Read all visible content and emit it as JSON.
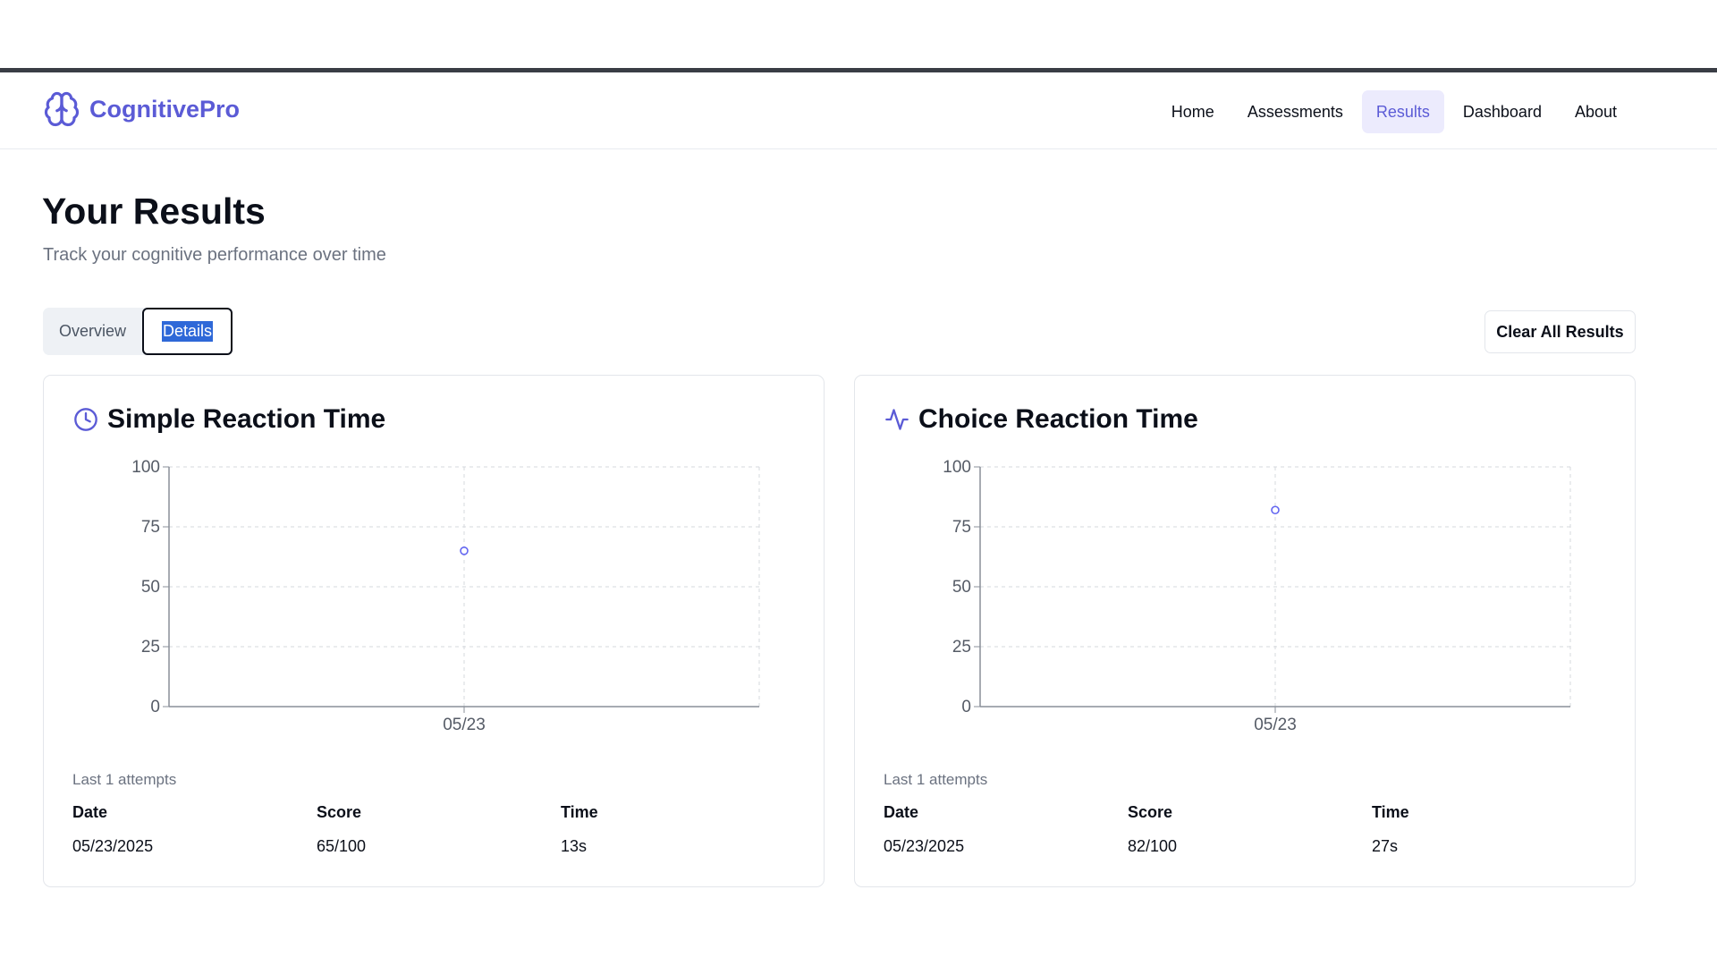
{
  "app": {
    "brand": "CognitivePro",
    "accent_color": "#5b5bd6"
  },
  "nav": {
    "items": [
      {
        "label": "Home",
        "active": false
      },
      {
        "label": "Assessments",
        "active": false
      },
      {
        "label": "Results",
        "active": true
      },
      {
        "label": "Dashboard",
        "active": false
      },
      {
        "label": "About",
        "active": false
      }
    ]
  },
  "page": {
    "title": "Your Results",
    "subtitle": "Track your cognitive performance over time"
  },
  "tabs": {
    "overview": "Overview",
    "details": "Details",
    "selected": "details"
  },
  "actions": {
    "clear_label": "Clear All Results"
  },
  "cards": [
    {
      "title": "Simple Reaction Time",
      "icon": "clock-icon",
      "attempts_label": "Last 1 attempts",
      "table": {
        "headers": [
          "Date",
          "Score",
          "Time"
        ],
        "rows": [
          [
            "05/23/2025",
            "65/100",
            "13s"
          ]
        ]
      }
    },
    {
      "title": "Choice Reaction Time",
      "icon": "activity-icon",
      "attempts_label": "Last 1 attempts",
      "table": {
        "headers": [
          "Date",
          "Score",
          "Time"
        ],
        "rows": [
          [
            "05/23/2025",
            "82/100",
            "27s"
          ]
        ]
      }
    }
  ],
  "chart_data": [
    {
      "type": "scatter",
      "categories": [
        "05/23"
      ],
      "values": [
        65
      ],
      "ylim": [
        0,
        100
      ],
      "yticks": [
        0,
        25,
        50,
        75,
        100
      ],
      "grid": true,
      "color": "#6366f1"
    },
    {
      "type": "scatter",
      "categories": [
        "05/23"
      ],
      "values": [
        82
      ],
      "ylim": [
        0,
        100
      ],
      "yticks": [
        0,
        25,
        50,
        75,
        100
      ],
      "grid": true,
      "color": "#6366f1"
    }
  ]
}
